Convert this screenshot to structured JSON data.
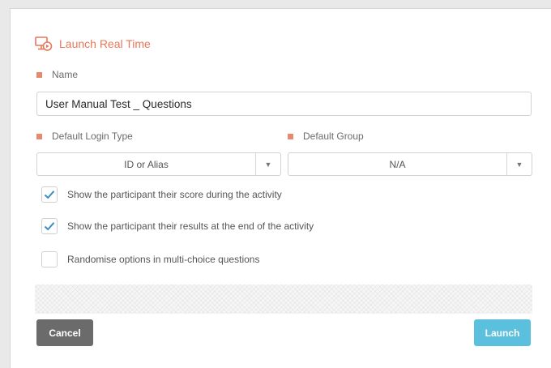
{
  "dialog": {
    "title": "Launch Real Time",
    "title_icon": "monitor-play-icon",
    "accent_color": "#e8775a"
  },
  "name_field": {
    "label": "Name",
    "value": "User Manual Test _ Questions"
  },
  "login_type": {
    "label": "Default Login Type",
    "selected": "ID or Alias",
    "arrow": "▼"
  },
  "default_group": {
    "label": "Default Group",
    "selected": "N/A",
    "arrow": "▼"
  },
  "options": [
    {
      "label": "Show the participant their score during the activity",
      "checked": true
    },
    {
      "label": "Show the participant their results at the end of the activity",
      "checked": true
    },
    {
      "label": "Randomise options in multi-choice questions",
      "checked": false
    }
  ],
  "buttons": {
    "cancel": "Cancel",
    "launch": "Launch",
    "cancel_color": "#6b6b6b",
    "launch_color": "#5bc0de"
  },
  "check_color": "#3a8ec4"
}
